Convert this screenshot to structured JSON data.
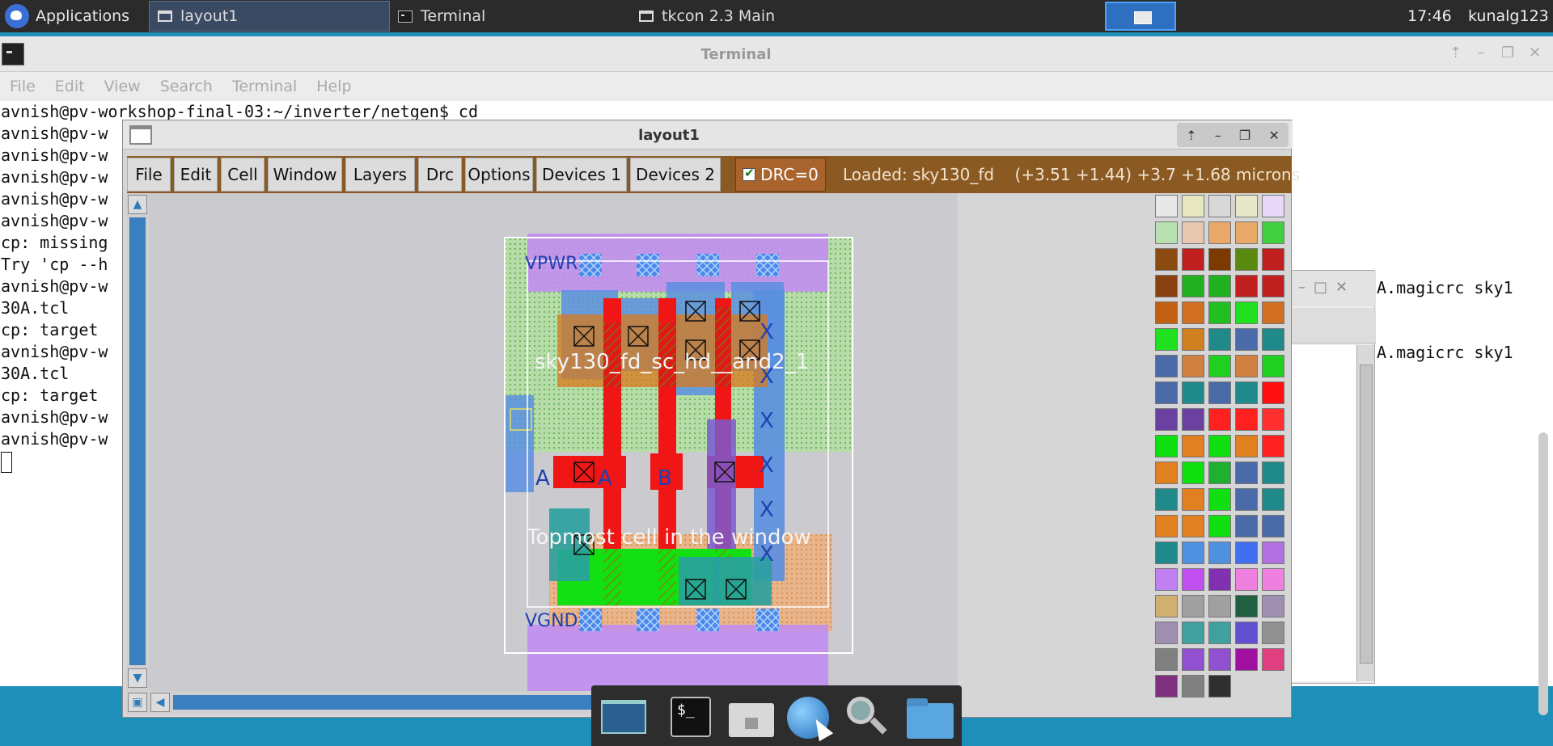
{
  "top_panel": {
    "applications_label": "Applications",
    "tasks": [
      {
        "label": "layout1"
      },
      {
        "label": "Terminal"
      },
      {
        "label": "tkcon 2.3 Main"
      }
    ],
    "clock": "17:46",
    "user": "kunalg123"
  },
  "terminal": {
    "title": "Terminal",
    "menu": [
      "File",
      "Edit",
      "View",
      "Search",
      "Terminal",
      "Help"
    ],
    "lines": [
      "avnish@pv-workshop-final-03:~/inverter/netgen$ cd",
      "avnish@pv-w",
      "avnish@pv-w",
      "avnish@pv-w",
      "avnish@pv-w",
      "avnish@pv-w",
      "cp: missing",
      "Try 'cp --h",
      "avnish@pv-w",
      "30A.tcl",
      "cp: target",
      "avnish@pv-w",
      "30A.tcl",
      "cp: target",
      "avnish@pv-w",
      "avnish@pv-w"
    ],
    "right_fragments": [
      "A.magicrc sky1",
      "A.magicrc sky1"
    ]
  },
  "layout_window": {
    "title": "layout1",
    "menu": [
      "File",
      "Edit",
      "Cell",
      "Window",
      "Layers",
      "Drc",
      "Options",
      "Devices 1",
      "Devices 2"
    ],
    "drc_label": "DRC=0",
    "loaded_text": "Loaded: sky130_fd    (+3.51 +1.44) +3.7 +1.68 microns",
    "cell_name": "sky130_fd_sc_hd__and2_1",
    "topmost_label": "Topmost cell in the window",
    "pin_labels": {
      "a1": "A",
      "a2": "A",
      "b": "B",
      "x": "X",
      "vpwr": "VPWR",
      "vgnd": "VGND"
    }
  },
  "dock": {
    "items": [
      "show-desktop",
      "terminal",
      "home-folder",
      "web-browser",
      "app-finder",
      "file-manager"
    ]
  },
  "palette_colors": [
    [
      "#e8e8e8",
      "#e8e8c0",
      "#d8d8d8",
      "#e8e8c8",
      "#e8d8f8"
    ],
    [
      "#b8e0b0",
      "#e8c8b0",
      "#e8a868",
      "#e8a868",
      "#40d040"
    ],
    [
      "#8a4a10",
      "#c02020",
      "#7a3a00",
      "#5a8a10",
      "#c02020"
    ],
    [
      "#8a4010",
      "#20b020",
      "#20b020",
      "#c02020",
      "#c02020"
    ],
    [
      "#c06010",
      "#d07020",
      "#20c020",
      "#20e020",
      "#d07020"
    ],
    [
      "#20e020",
      "#d08020",
      "#208a8a",
      "#4a6aa8",
      "#208a8a"
    ],
    [
      "#4a6aa8",
      "#d08040",
      "#20d020",
      "#d08040",
      "#20d020"
    ],
    [
      "#4a6aa8",
      "#208a8a",
      "#4a6aa8",
      "#208a8a",
      "#ff1010"
    ],
    [
      "#6a40a0",
      "#6a40a0",
      "#ff2020",
      "#ff2020",
      "#ff3030"
    ],
    [
      "#10e010",
      "#e08020",
      "#10e010",
      "#e08020",
      "#ff2020"
    ],
    [
      "#e08020",
      "#10e010",
      "#20b030",
      "#4a6aa8",
      "#208a8a"
    ],
    [
      "#208a8a",
      "#e08020",
      "#10e010",
      "#4a6aa8",
      "#208a8a"
    ],
    [
      "#e08020",
      "#e08020",
      "#10e010",
      "#4a6aa8",
      "#4a6aa8"
    ],
    [
      "#208a8a",
      "#5090e0",
      "#5090e0",
      "#4070f0",
      "#b070e0"
    ],
    [
      "#c080f0",
      "#c050f0",
      "#8030b0",
      "#f080e0",
      "#f080e0"
    ],
    [
      "#d0b070",
      "#a0a0a0",
      "#a0a0a0",
      "#206040",
      "#a090b0"
    ],
    [
      "#a090b0",
      "#40a0a0",
      "#40a0a0",
      "#6050d0",
      "#909090"
    ],
    [
      "#808080",
      "#9050d0",
      "#9050d0",
      "#a010a0",
      "#e04080"
    ],
    [
      "#803080",
      "#808080",
      "#303030"
    ]
  ]
}
